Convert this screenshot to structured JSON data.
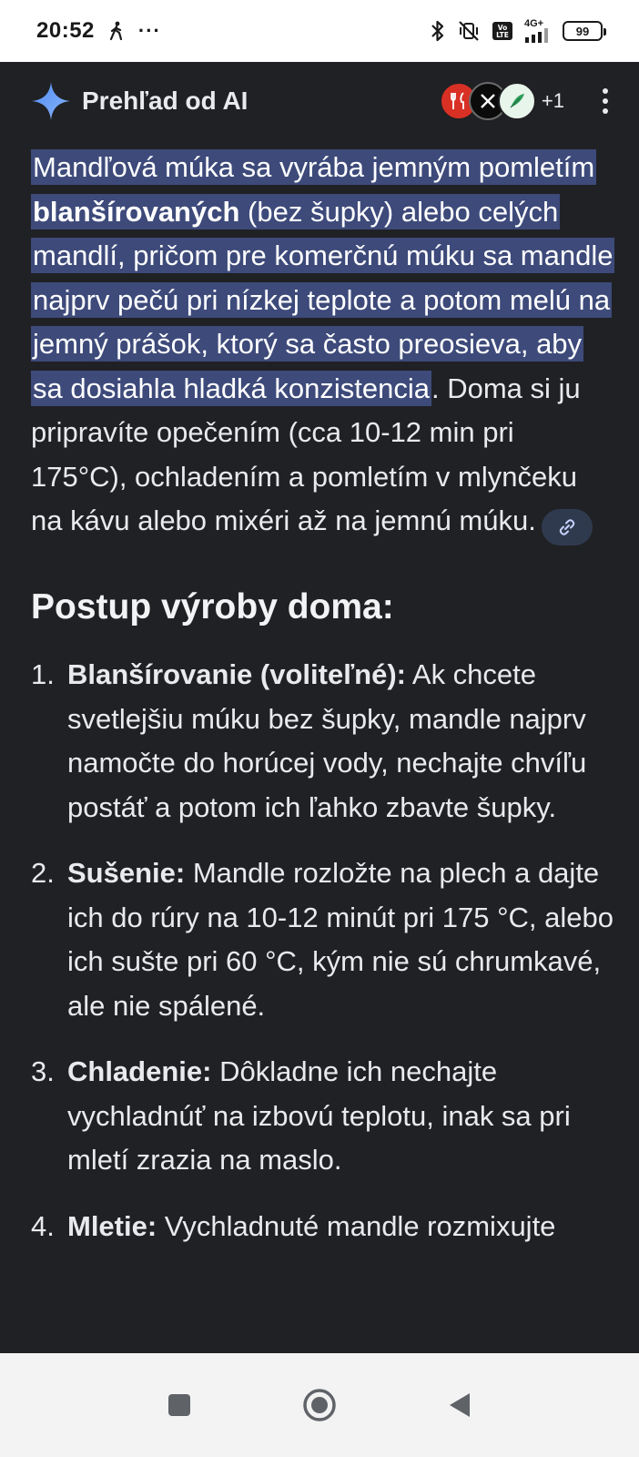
{
  "status_bar": {
    "time": "20:52",
    "dots": "···",
    "network_label": "4G+",
    "battery": "99"
  },
  "header": {
    "title": "Prehľad od AI",
    "extra_sources": "+1"
  },
  "summary": {
    "highlight_1": "Mandľová múka sa vyrába jemným pomletím ",
    "highlight_bold": "blanšírovaných",
    "highlight_2": " (bez šupky) alebo celých mandlí, pričom pre komerčnú múku sa mandle najprv pečú pri nízkej teplote a potom melú na jemný prášok, ktorý sa často preosieva, aby sa dosiahla hladká konzistencia",
    "rest": ". Doma si ju pripravíte opečením (cca 10-12 min pri 175°C), ochladením a pomletím v mlynčeku na kávu alebo mixéri až na jemnú múku."
  },
  "section_heading": "Postup výroby doma:",
  "steps": [
    {
      "num": "1.",
      "title": "Blanšírovanie (voliteľné):",
      "text": " Ak chcete svetlejšiu múku bez šupky, mandle najprv namočte do horúcej vody, nechajte chvíľu postáť a potom ich ľahko zbavte šupky."
    },
    {
      "num": "2.",
      "title": "Sušenie:",
      "text": " Mandle rozložte na plech a dajte ich do rúry na 10-12 minút pri 175 °C, alebo ich sušte pri 60 °C, kým nie sú chrumkavé, ale nie spálené."
    },
    {
      "num": "3.",
      "title": "Chladenie:",
      "text": " Dôkladne ich nechajte vychladnúť na izbovú teplotu, inak sa pri mletí zrazia na maslo."
    },
    {
      "num": "4.",
      "title": "Mletie:",
      "text": " Vychladnuté mandle rozmixujte"
    }
  ],
  "colors": {
    "background": "#202124",
    "highlight": "#3d4a7a",
    "text": "#e8eaed"
  },
  "icons": {
    "sparkle": "gemini-sparkle-icon",
    "link": "link-icon",
    "nav_square": "recents-square-icon",
    "nav_home": "home-circle-icon",
    "nav_back": "back-triangle-icon"
  }
}
